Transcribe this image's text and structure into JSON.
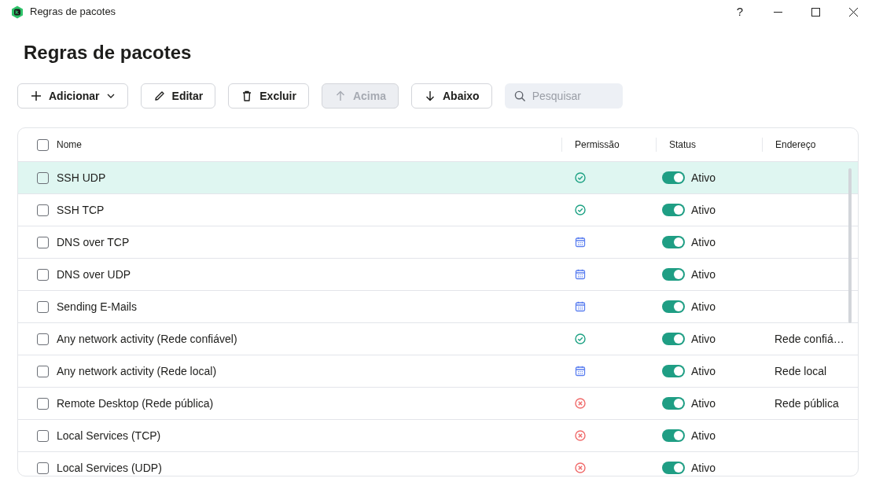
{
  "window": {
    "title": "Regras de pacotes",
    "help": "?"
  },
  "heading": "Regras de pacotes",
  "toolbar": [
    {
      "kind": "add",
      "label": "Adicionar",
      "disabled": false
    },
    {
      "kind": "edit",
      "label": "Editar",
      "disabled": false
    },
    {
      "kind": "delete",
      "label": "Excluir",
      "disabled": false
    },
    {
      "kind": "up",
      "label": "Acima",
      "disabled": true
    },
    {
      "kind": "down",
      "label": "Abaixo",
      "disabled": false
    }
  ],
  "search": {
    "placeholder": "Pesquisar"
  },
  "table": {
    "select_all_checked": false,
    "columns": [
      "Nome",
      "Permissão",
      "Status",
      "Endereço"
    ],
    "rows": [
      {
        "name": "SSH UDP",
        "permission": {
          "kind": "allow"
        },
        "on": true,
        "status": "Ativo",
        "selected": true,
        "checked": false
      },
      {
        "name": "SSH TCP",
        "permission": {
          "kind": "allow"
        },
        "on": true,
        "status": "Ativo",
        "selected": false,
        "checked": false
      },
      {
        "name": "DNS over TCP",
        "permission": {
          "kind": "schedule"
        },
        "on": true,
        "status": "Ativo",
        "selected": false,
        "checked": false
      },
      {
        "name": "DNS over UDP",
        "permission": {
          "kind": "schedule"
        },
        "on": true,
        "status": "Ativo",
        "selected": false,
        "checked": false
      },
      {
        "name": "Sending E-Mails",
        "permission": {
          "kind": "schedule"
        },
        "on": true,
        "status": "Ativo",
        "selected": false,
        "checked": false
      },
      {
        "name": "Any network activity (Rede confiável)",
        "permission": {
          "kind": "allow"
        },
        "on": true,
        "status": "Ativo",
        "address": "Rede confiá…",
        "selected": false,
        "checked": false
      },
      {
        "name": "Any network activity (Rede local)",
        "permission": {
          "kind": "schedule"
        },
        "on": true,
        "status": "Ativo",
        "address": "Rede local",
        "selected": false,
        "checked": false
      },
      {
        "name": "Remote Desktop (Rede pública)",
        "permission": {
          "kind": "block"
        },
        "on": true,
        "status": "Ativo",
        "address": "Rede pública",
        "selected": false,
        "checked": false
      },
      {
        "name": "Local Services (TCP)",
        "permission": {
          "kind": "block"
        },
        "on": true,
        "status": "Ativo",
        "selected": false,
        "checked": false
      },
      {
        "name": "Local Services (UDP)",
        "permission": {
          "kind": "block"
        },
        "on": true,
        "status": "Ativo",
        "selected": false,
        "checked": false
      }
    ]
  }
}
